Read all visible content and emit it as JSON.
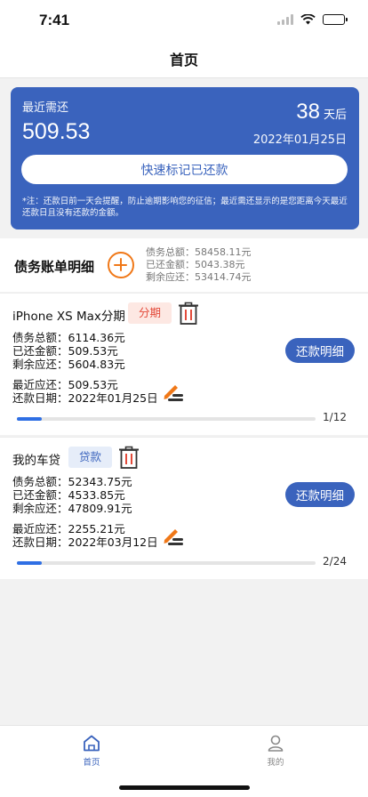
{
  "status_bar": {
    "time": "7:41"
  },
  "nav": {
    "title": "首页"
  },
  "summary": {
    "label": "最近需还",
    "amount": "509.53",
    "days": "38",
    "days_unit": "天后",
    "date": "2022年01月25日",
    "quick_button": "快速标记已还款",
    "note": "*注：还款日前一天会提醒，防止逾期影响您的征信；最近需还显示的是您距离今天最近还款日且没有还款的金额。"
  },
  "detail_header": {
    "title": "债务账单明细",
    "total": "债务总额：58458.11元",
    "paid": "已还金额：5043.38元",
    "remaining": "剩余应还：53414.74元"
  },
  "debts": [
    {
      "name": "iPhone XS Max分期",
      "tag": "分期",
      "total": "债务总额：6114.36元",
      "paid": "已还金额：509.53元",
      "remaining": "剩余应还：5604.83元",
      "recent": "最近应还：509.53元",
      "date": "还款日期：2022年01月25日",
      "button": "还款明细",
      "progress_label": "1/12",
      "progress": 0.0833
    },
    {
      "name": "我的车贷",
      "tag": "贷款",
      "total": "债务总额：52343.75元",
      "paid": "已还金额：4533.85元",
      "remaining": "剩余应还：47809.91元",
      "recent": "最近应还：2255.21元",
      "date": "还款日期：2022年03月12日",
      "button": "还款明细",
      "progress_label": "2/24",
      "progress": 0.0833
    }
  ],
  "tabs": [
    {
      "label": "首页",
      "icon": "home-icon",
      "active": true
    },
    {
      "label": "我的",
      "icon": "user-icon",
      "active": false
    }
  ],
  "colors": {
    "primary": "#3a63bd",
    "accent": "#f07818",
    "danger": "#e34a3a",
    "progress": "#2f6fe4"
  }
}
